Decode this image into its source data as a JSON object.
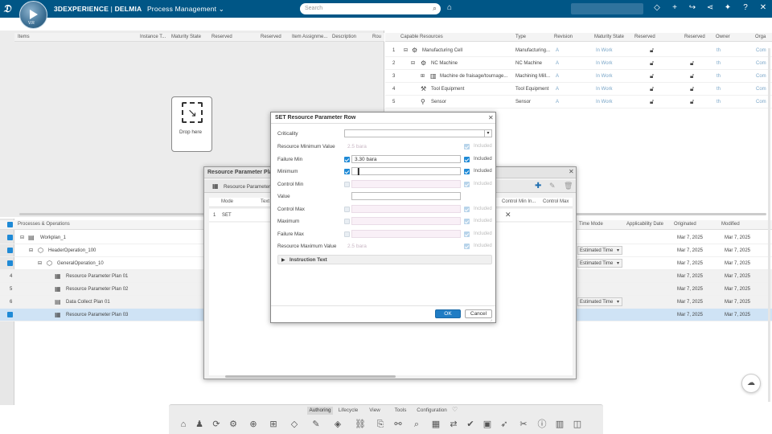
{
  "app": {
    "brand_bold": "3DEXPERIENCE",
    "brand_sep": " | ",
    "brand_app": "DELMIA",
    "brand_module": "Process Management",
    "compass_version": "V.R",
    "search_placeholder": "Search"
  },
  "top_panel": {
    "headers": [
      "Items",
      "Instance T...",
      "Maturity State",
      "Reserved",
      "Reserved",
      "Item Assignme...",
      "Description",
      "Rou"
    ],
    "drop_here": "Drop here"
  },
  "resources": {
    "headers": [
      "Capable Resources",
      "Type",
      "Revision",
      "Maturity State",
      "Reserved",
      "Reserved",
      "Owner",
      "Orga"
    ],
    "rows": [
      {
        "num": "1",
        "name": "Manufacturing Cell",
        "type": "Manufacturing...",
        "rev": "A",
        "state": "In Work",
        "owner": "th",
        "org": "Com"
      },
      {
        "num": "2",
        "name": "NC Machine",
        "type": "NC Machine",
        "rev": "A",
        "state": "In Work",
        "owner": "th",
        "org": "Com"
      },
      {
        "num": "3",
        "name": "Machine de fraisage/tournage...",
        "type": "Machining Mill...",
        "rev": "A",
        "state": "In Work",
        "owner": "th",
        "org": "Com"
      },
      {
        "num": "4",
        "name": "Tool Equipment",
        "type": "Tool Equipment",
        "rev": "A",
        "state": "In Work",
        "owner": "th",
        "org": "Com"
      },
      {
        "num": "5",
        "name": "Sensor",
        "type": "Sensor",
        "rev": "A",
        "state": "In Work",
        "owner": "th",
        "org": "Com"
      }
    ]
  },
  "processes": {
    "header": "Processes & Operations",
    "right_headers": [
      "Time Mode",
      "Applicability Date",
      "Originated",
      "Modified"
    ],
    "rows": [
      {
        "num": "",
        "name": "Workplan_1",
        "time_mode": "",
        "originated": "Mar 7, 2025",
        "modified": "Mar 7, 2025"
      },
      {
        "num": "",
        "name": "HeaderOperation_100",
        "time_mode": "Estimated Time",
        "originated": "Mar 7, 2025",
        "modified": "Mar 7, 2025"
      },
      {
        "num": "",
        "name": "GeneralOperation_10",
        "time_mode": "Estimated Time",
        "originated": "Mar 7, 2025",
        "modified": "Mar 7, 2025"
      },
      {
        "num": "4",
        "name": "Resource Parameter Plan 01",
        "time_mode": "",
        "originated": "Mar 7, 2025",
        "modified": "Mar 7, 2025"
      },
      {
        "num": "5",
        "name": "Resource Parameter Plan 02",
        "time_mode": "",
        "originated": "Mar 7, 2025",
        "modified": "Mar 7, 2025"
      },
      {
        "num": "6",
        "name": "Data Collect Plan 01",
        "time_mode": "Estimated Time",
        "originated": "Mar 7, 2025",
        "modified": "Mar 7, 2025"
      },
      {
        "num": "7",
        "name": "Resource Parameter Plan 03",
        "time_mode": "",
        "originated": "Mar 7, 2025",
        "modified": "Mar 7, 2025"
      }
    ]
  },
  "rpp_panel": {
    "title": "Resource Parameter Pla",
    "tab_label": "Resource Parameter P",
    "headers": [
      "Mode",
      "Text",
      "Control Min In...",
      "Control Max"
    ],
    "row_num": "1",
    "row_mode": "SET"
  },
  "dialog": {
    "title": "SET Resource Parameter Row",
    "criticality_label": "Criticality",
    "criticality_value": "",
    "rows": [
      {
        "label": "Resource Minimum Value",
        "value": "2.5 bara",
        "included": "Included"
      },
      {
        "label": "Failure Min",
        "value": "3.30 bara",
        "included": "Included"
      },
      {
        "label": "Minimum",
        "value": "",
        "included": "Included"
      },
      {
        "label": "Control Min",
        "value": "",
        "included": "Included"
      },
      {
        "label": "Value",
        "value": "",
        "included": ""
      },
      {
        "label": "Control Max",
        "value": "",
        "included": "Included"
      },
      {
        "label": "Maximum",
        "value": "",
        "included": "Included"
      },
      {
        "label": "Failure Max",
        "value": "",
        "included": "Included"
      },
      {
        "label": "Resource Maximum Value",
        "value": "2.5 bara",
        "included": "Included"
      }
    ],
    "instruction_text": "Instruction Text",
    "ok_label": "OK",
    "cancel_label": "Cancel"
  },
  "bottom_tabs": [
    "Authoring",
    "Lifecycle",
    "View",
    "Tools",
    "Configuration"
  ]
}
